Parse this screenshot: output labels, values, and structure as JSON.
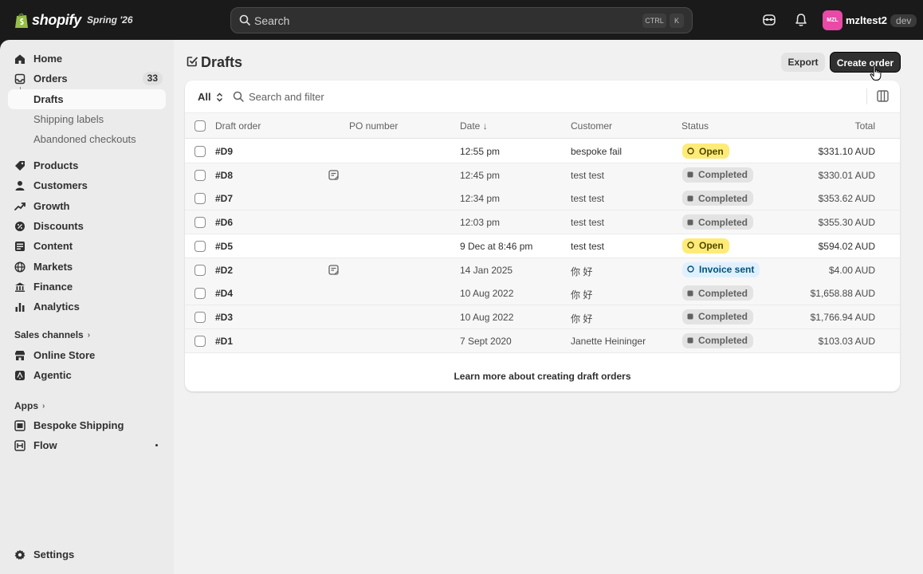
{
  "topbar": {
    "logo_text": "shopify",
    "release_label": "Spring '26",
    "search": {
      "placeholder": "Search",
      "shortcut_modifier": "CTRL",
      "shortcut_key": "K"
    },
    "user": {
      "initials": "MZL",
      "store_name": "mzltest2",
      "env_badge": "dev"
    }
  },
  "sidebar": {
    "home": "Home",
    "orders": {
      "label": "Orders",
      "count": "33"
    },
    "orders_sub": [
      "Drafts",
      "Shipping labels",
      "Abandoned checkouts"
    ],
    "main_items": [
      "Products",
      "Customers",
      "Growth",
      "Discounts",
      "Content",
      "Markets",
      "Finance",
      "Analytics"
    ],
    "sales_channels_label": "Sales channels",
    "sales_channels": [
      "Online Store",
      "Agentic"
    ],
    "apps_label": "Apps",
    "apps": [
      "Bespoke Shipping",
      "Flow"
    ],
    "settings": "Settings"
  },
  "page": {
    "title": "Drafts",
    "export_label": "Export",
    "create_label": "Create order",
    "filter_all": "All",
    "filter_search_placeholder": "Search and filter",
    "columns": {
      "draft_order": "Draft order",
      "po_number": "PO number",
      "date": "Date",
      "customer": "Customer",
      "status": "Status",
      "total": "Total"
    },
    "rows": [
      {
        "id": "#D9",
        "note": false,
        "date": "12:55 pm",
        "customer": "bespoke fail",
        "status": "Open",
        "status_kind": "open",
        "total": "$331.10 AUD"
      },
      {
        "id": "#D8",
        "note": true,
        "date": "12:45 pm",
        "customer": "test test",
        "status": "Completed",
        "status_kind": "completed",
        "total": "$330.01 AUD"
      },
      {
        "id": "#D7",
        "note": false,
        "date": "12:34 pm",
        "customer": "test test",
        "status": "Completed",
        "status_kind": "completed",
        "total": "$353.62 AUD"
      },
      {
        "id": "#D6",
        "note": false,
        "date": "12:03 pm",
        "customer": "test test",
        "status": "Completed",
        "status_kind": "completed",
        "total": "$355.30 AUD"
      },
      {
        "id": "#D5",
        "note": false,
        "date": "9 Dec at 8:46 pm",
        "customer": "test test",
        "status": "Open",
        "status_kind": "open",
        "total": "$594.02 AUD"
      },
      {
        "id": "#D2",
        "note": true,
        "date": "14 Jan 2025",
        "customer": "你 好",
        "status": "Invoice sent",
        "status_kind": "invoice",
        "total": "$4.00 AUD"
      },
      {
        "id": "#D4",
        "note": false,
        "date": "10 Aug 2022",
        "customer": "你 好",
        "status": "Completed",
        "status_kind": "completed",
        "total": "$1,658.88 AUD"
      },
      {
        "id": "#D3",
        "note": false,
        "date": "10 Aug 2022",
        "customer": "你 好",
        "status": "Completed",
        "status_kind": "completed",
        "total": "$1,766.94 AUD"
      },
      {
        "id": "#D1",
        "note": false,
        "date": "7 Sept 2020",
        "customer": "Janette Heininger",
        "status": "Completed",
        "status_kind": "completed",
        "total": "$103.03 AUD"
      }
    ],
    "footer_link": "Learn more about creating draft orders"
  },
  "colors": {
    "topbar_bg": "#1a1a1a",
    "open_badge": "#ffeb78",
    "completed_badge": "#e3e3e3",
    "invoice_badge": "#e0f0ff",
    "avatar": "#e84aa6"
  }
}
